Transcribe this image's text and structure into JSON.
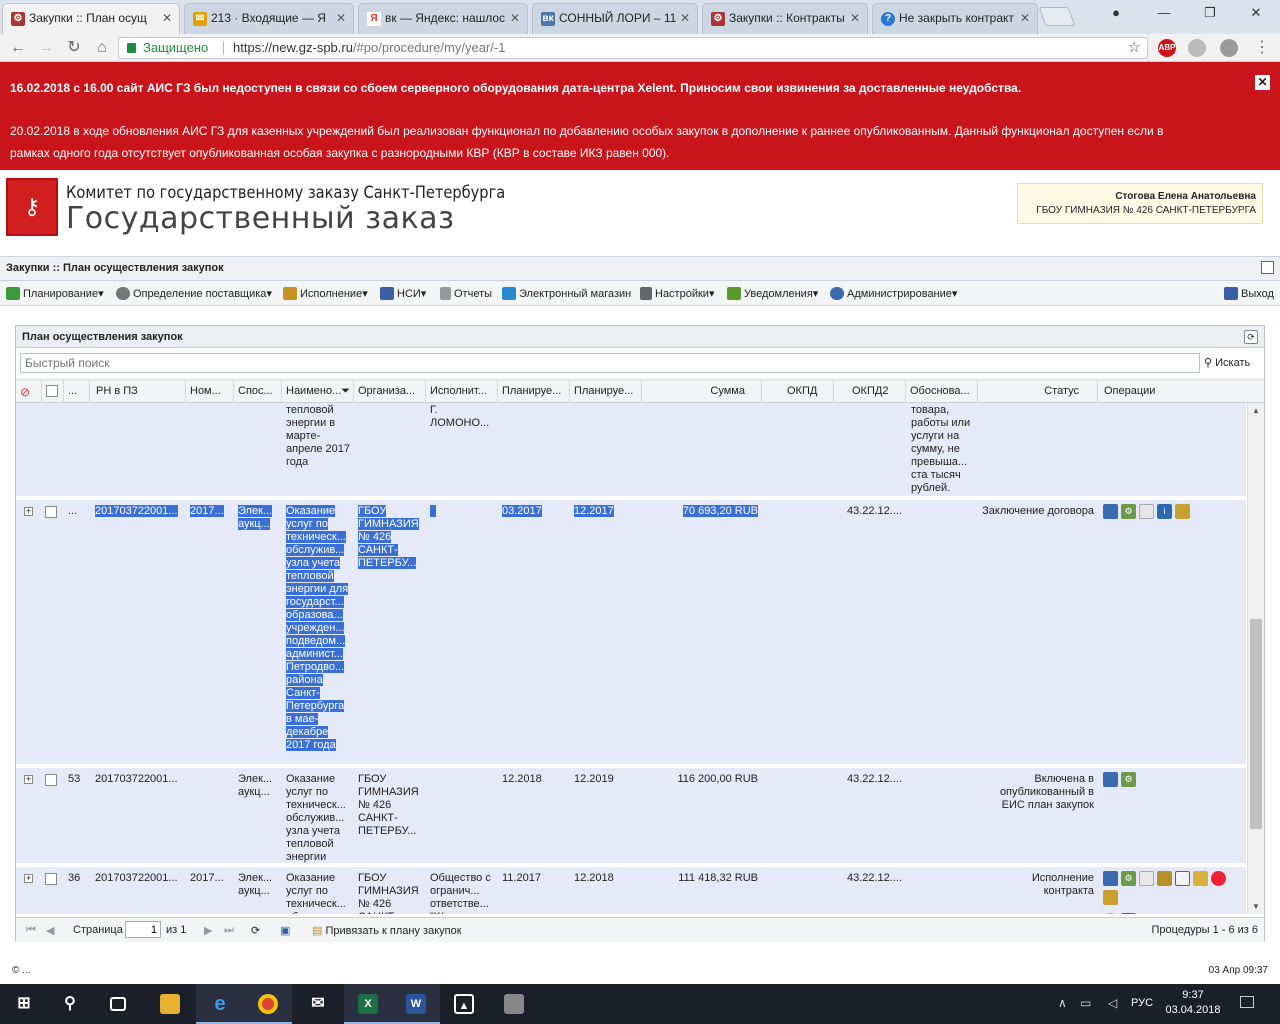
{
  "browser": {
    "tabs": [
      {
        "title": "Закупки :: План осущ",
        "favicon": "gear-icon",
        "color": "#a33"
      },
      {
        "title": "213 · Входящие — Я",
        "favicon": "mail-icon",
        "color": "#e0a000"
      },
      {
        "title": "вк — Яндекс: нашлос",
        "favicon": "yandex-icon",
        "color": "#e32"
      },
      {
        "title": "СОННЫЙ ЛОРИ – 11",
        "favicon": "vk-icon",
        "color": "#4a76a8"
      },
      {
        "title": "Закупки :: Контракты",
        "favicon": "gear-icon",
        "color": "#a33"
      },
      {
        "title": "Не закрыть контракт",
        "favicon": "question-icon",
        "color": "#2a7ad0"
      }
    ],
    "secure_label": "Защищено",
    "url_host": "https://new.gz-spb.ru",
    "url_path": "/#po/procedure/my/year/-1",
    "ext_abp": "ABP"
  },
  "notice": {
    "line1": "16.02.2018 с 16.00 сайт АИС ГЗ был недоступен в связи со сбоем серверного оборудования дата-центра Xelent. Приносим свои извинения за доставленные неудобства.",
    "line2": "20.02.2018 в ходе обновления АИС ГЗ для казенных учреждений был реализован функционал по добавлению особых закупок в дополнение к раннее опубликованным. Данный функционал доступен если в",
    "line3": "рамках одного года отсутствует опубликованная особая закупка с разнородными КВР (КВР в составе ИКЗ равен 000).",
    "close": "✕"
  },
  "header": {
    "org_line1": "Комитет по государственному заказу Санкт-Петербурга",
    "org_line2": "Государственный заказ",
    "user_name": "Стогова Елена Анатольевна",
    "user_org": "ГБОУ ГИМНАЗИЯ № 426 САНКТ-ПЕТЕРБУРГА"
  },
  "appbar": {
    "title": "Закупки :: План осуществления закупок"
  },
  "menu": [
    {
      "label": "Планирование",
      "icon": "planning-icon",
      "color": "#3a9a3a",
      "dropdown": true
    },
    {
      "label": "Определение поставщика",
      "icon": "supplier-icon",
      "color": "#777",
      "dropdown": true
    },
    {
      "label": "Исполнение",
      "icon": "execution-icon",
      "color": "#c89020",
      "dropdown": true
    },
    {
      "label": "НСИ",
      "icon": "book-icon",
      "color": "#3a5ea8",
      "dropdown": true
    },
    {
      "label": "Отчеты",
      "icon": "report-icon",
      "color": "#999",
      "dropdown": false
    },
    {
      "label": "Электронный магазин",
      "icon": "cart-icon",
      "color": "#2a8ad0",
      "dropdown": false
    },
    {
      "label": "Настройки",
      "icon": "wrench-icon",
      "color": "#666",
      "dropdown": true
    },
    {
      "label": "Уведомления",
      "icon": "notify-icon",
      "color": "#5a9a2a",
      "dropdown": true
    },
    {
      "label": "Администрирование",
      "icon": "user-icon",
      "color": "#3a6ab0",
      "dropdown": true
    }
  ],
  "logout": "Выход",
  "panel": {
    "title": "План осуществления закупок",
    "search_placeholder": "Быстрый поиск",
    "search_button": "Искать"
  },
  "columns": [
    "...",
    "РН в ПЗ",
    "Ном...",
    "Спос...",
    "Наимено...",
    "Организа...",
    "Исполнит...",
    "Планируе...",
    "Планируе...",
    "Сумма",
    "ОКПД",
    "ОКПД2",
    "Обоснова...",
    "Статус",
    "Операции"
  ],
  "rows": [
    {
      "num": "",
      "rn": "",
      "nom": "",
      "method": "",
      "name": "тепловой энергии в марте-апреле 2017 года",
      "org": "",
      "executor": "Г. ЛОМОНО...",
      "plan1": "",
      "plan2": "",
      "sum": "",
      "okpd2": "",
      "basis": "товара, работы или услуги на сумму, не превыша... ста тысяч рублей.",
      "status": "",
      "ops": []
    },
    {
      "num": "...",
      "rn": "201703722001...",
      "nom": "2017...",
      "method": "Элек... аукц...",
      "name": "Оказание услуг по техническ... обслужив... узла учета тепловой энергии для государст... образова... учрежден... подведом... админист... Петродво... района Санкт-Петербурга в мае-декабре 2017 года",
      "org": "ГБОУ ГИМНАЗИЯ № 426 САНКТ-ПЕТЕРБУ...",
      "executor": "",
      "plan1": "03.2017",
      "plan2": "12.2017",
      "sum": "70 693,20 RUB",
      "okpd2": "43.22.12....",
      "basis": "",
      "status": "Заключение договора",
      "ops": [
        "chart-icon",
        "gears-icon",
        "doc-icon",
        "info-icon",
        "scroll-icon"
      ]
    },
    {
      "num": "53",
      "rn": "201703722001...",
      "nom": "",
      "method": "Элек... аукц...",
      "name": "Оказание услуг по техническ... обслужив... узла учета тепловой энергии",
      "org": "ГБОУ ГИМНАЗИЯ № 426 САНКТ-ПЕТЕРБУ...",
      "executor": "",
      "plan1": "12.2018",
      "plan2": "12.2019",
      "sum": "116 200,00 RUB",
      "okpd2": "43.22.12....",
      "basis": "",
      "status": "Включена в опубликованный в ЕИС план закупок",
      "ops": [
        "chart-icon",
        "gears-icon"
      ]
    },
    {
      "num": "36",
      "rn": "201703722001...",
      "nom": "2017...",
      "method": "Элек... аукц...",
      "name": "Оказание услуг по техническ... обслужив...",
      "org": "ГБОУ ГИМНАЗИЯ № 426 САНКТ...",
      "executor": "Общество с огранич... ответстве... \"Жилкомс...",
      "plan1": "11.2017",
      "plan2": "12.2018",
      "sum": "111 418,32 RUB",
      "okpd2": "43.22.12....",
      "basis": "",
      "status": "Исполнение контракта",
      "ops": [
        "chart-icon",
        "gears-icon",
        "doc-icon",
        "emblem-icon",
        "list-icon",
        "edit-icon",
        "record-icon",
        "scroll-icon",
        "coins-icon",
        "stats-icon"
      ]
    }
  ],
  "pager": {
    "page_label": "Страница",
    "page_value": "1",
    "of_label": "из 1",
    "bind_plan": "Привязать к плану закупок",
    "range": "Процедуры 1 - 6 из 6"
  },
  "footer": {
    "left": "© ...",
    "right": "03 Апр 09:37"
  },
  "taskbar": {
    "lang": "РУС",
    "time": "9:37",
    "date": "03.04.2018"
  }
}
